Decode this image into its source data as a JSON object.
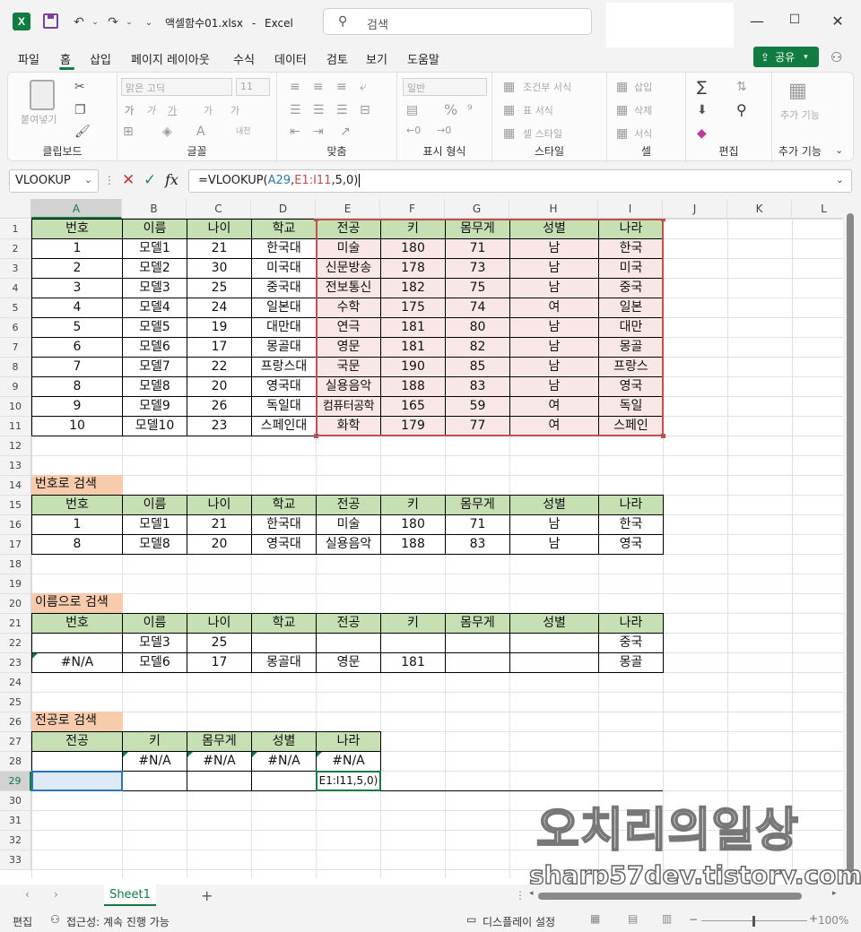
{
  "titlebar": {
    "filename": "액셀함수01.xlsx",
    "app_name": "Excel",
    "title_sep": "-",
    "search_placeholder": "검색",
    "logo_letter": "X"
  },
  "menu": {
    "items": [
      "파일",
      "홈",
      "삽입",
      "페이지 레이아웃",
      "수식",
      "데이터",
      "검토",
      "보기",
      "도움말"
    ],
    "active": "홈",
    "share_label": "공유"
  },
  "ribbon": {
    "clipboard": {
      "label": "클립보드",
      "paste": "붙여넣기"
    },
    "font": {
      "label": "글꼴",
      "font_name": "맑은 고딕",
      "font_size": "11",
      "bold": "가",
      "italic": "가",
      "underline": "가",
      "grow": "가",
      "shrink": "가",
      "phonetic": "내천"
    },
    "align": {
      "label": "맞춤"
    },
    "number": {
      "label": "표시 형식",
      "format": "일반"
    },
    "styles": {
      "label": "스타일",
      "conditional": "조건부 서식",
      "table": "표 서식",
      "cell": "셀 스타일"
    },
    "cells": {
      "label": "셀",
      "insert": "삽입",
      "delete": "삭제",
      "format": "서식"
    },
    "editing": {
      "label": "편집"
    },
    "addins": {
      "label": "추가 기능",
      "button": "추가 기능"
    }
  },
  "formula_bar": {
    "name_box": "VLOOKUP",
    "formula_prefix": "=VLOOKUP(",
    "formula_ref1": "A29",
    "formula_comma1": ",",
    "formula_ref2": "E1:I11",
    "formula_suffix": ",5,0)"
  },
  "columns": [
    "A",
    "B",
    "C",
    "D",
    "E",
    "F",
    "G",
    "H",
    "I",
    "J",
    "K",
    "L"
  ],
  "selected_column": "A",
  "selected_row": 29,
  "rows": [
    "1",
    "2",
    "3",
    "4",
    "5",
    "6",
    "7",
    "8",
    "9",
    "10",
    "11",
    "12",
    "13",
    "14",
    "15",
    "16",
    "17",
    "18",
    "19",
    "20",
    "21",
    "22",
    "23",
    "24",
    "25",
    "26",
    "27",
    "28",
    "29",
    "30",
    "31",
    "32",
    "33"
  ],
  "main_table": {
    "headers": [
      "번호",
      "이름",
      "나이",
      "학교",
      "전공",
      "키",
      "몸무게",
      "성별",
      "나라"
    ],
    "rows": [
      [
        "1",
        "모델1",
        "21",
        "한국대",
        "미술",
        "180",
        "71",
        "남",
        "한국"
      ],
      [
        "2",
        "모델2",
        "30",
        "미국대",
        "신문방송",
        "178",
        "73",
        "남",
        "미국"
      ],
      [
        "3",
        "모델3",
        "25",
        "중국대",
        "전보통신",
        "182",
        "75",
        "남",
        "중국"
      ],
      [
        "4",
        "모델4",
        "24",
        "일본대",
        "수학",
        "175",
        "74",
        "여",
        "일본"
      ],
      [
        "5",
        "모델5",
        "19",
        "대만대",
        "연극",
        "181",
        "80",
        "남",
        "대만"
      ],
      [
        "6",
        "모델6",
        "17",
        "몽골대",
        "영문",
        "181",
        "82",
        "남",
        "몽골"
      ],
      [
        "7",
        "모델7",
        "22",
        "프랑스대",
        "국문",
        "190",
        "85",
        "남",
        "프랑스"
      ],
      [
        "8",
        "모델8",
        "20",
        "영국대",
        "실용음악",
        "188",
        "83",
        "남",
        "영국"
      ],
      [
        "9",
        "모델9",
        "26",
        "독일대",
        "컴퓨터공학",
        "165",
        "59",
        "여",
        "독일"
      ],
      [
        "10",
        "모델10",
        "23",
        "스페인대",
        "화학",
        "179",
        "77",
        "여",
        "스페인"
      ]
    ]
  },
  "search_by_number": {
    "title": "번호로 검색",
    "headers": [
      "번호",
      "이름",
      "나이",
      "학교",
      "전공",
      "키",
      "몸무게",
      "성별",
      "나라"
    ],
    "rows": [
      [
        "1",
        "모델1",
        "21",
        "한국대",
        "미술",
        "180",
        "71",
        "남",
        "한국"
      ],
      [
        "8",
        "모델8",
        "20",
        "영국대",
        "실용음악",
        "188",
        "83",
        "남",
        "영국"
      ]
    ]
  },
  "search_by_name": {
    "title": "이름으로 검색",
    "headers": [
      "번호",
      "이름",
      "나이",
      "학교",
      "전공",
      "키",
      "몸무게",
      "성별",
      "나라"
    ],
    "rows": [
      [
        "",
        "모델3",
        "25",
        "",
        "",
        "",
        "",
        "",
        "중국"
      ],
      [
        "#N/A",
        "모델6",
        "17",
        "몽골대",
        "영문",
        "181",
        "",
        "",
        "몽골"
      ]
    ]
  },
  "search_by_major": {
    "title": "전공로 검색",
    "headers": [
      "전공",
      "키",
      "몸무게",
      "성별",
      "나라"
    ],
    "rows": [
      [
        "",
        "#N/A",
        "#N/A",
        "#N/A",
        "#N/A"
      ],
      [
        "",
        "",
        "",
        "",
        "E1:I11,5,0)"
      ]
    ]
  },
  "sheet_tabs": [
    "Sheet1"
  ],
  "status": {
    "mode": "편집",
    "accessibility": "접근성: 계속 진행 가능",
    "display_settings": "디스플레이 설정",
    "zoom": "100%"
  },
  "watermark": {
    "line1": "오치리의일상",
    "line2": "sharp57dev.tistory.com"
  },
  "colors": {
    "header_green": "#c6e0b4",
    "title_orange": "#f8cbad",
    "range_fill": "#f9e6e6",
    "range_border": "#c0504d",
    "excel_green": "#107c41",
    "formula_blue": "#2e75b6",
    "formula_red": "#c0504d"
  }
}
